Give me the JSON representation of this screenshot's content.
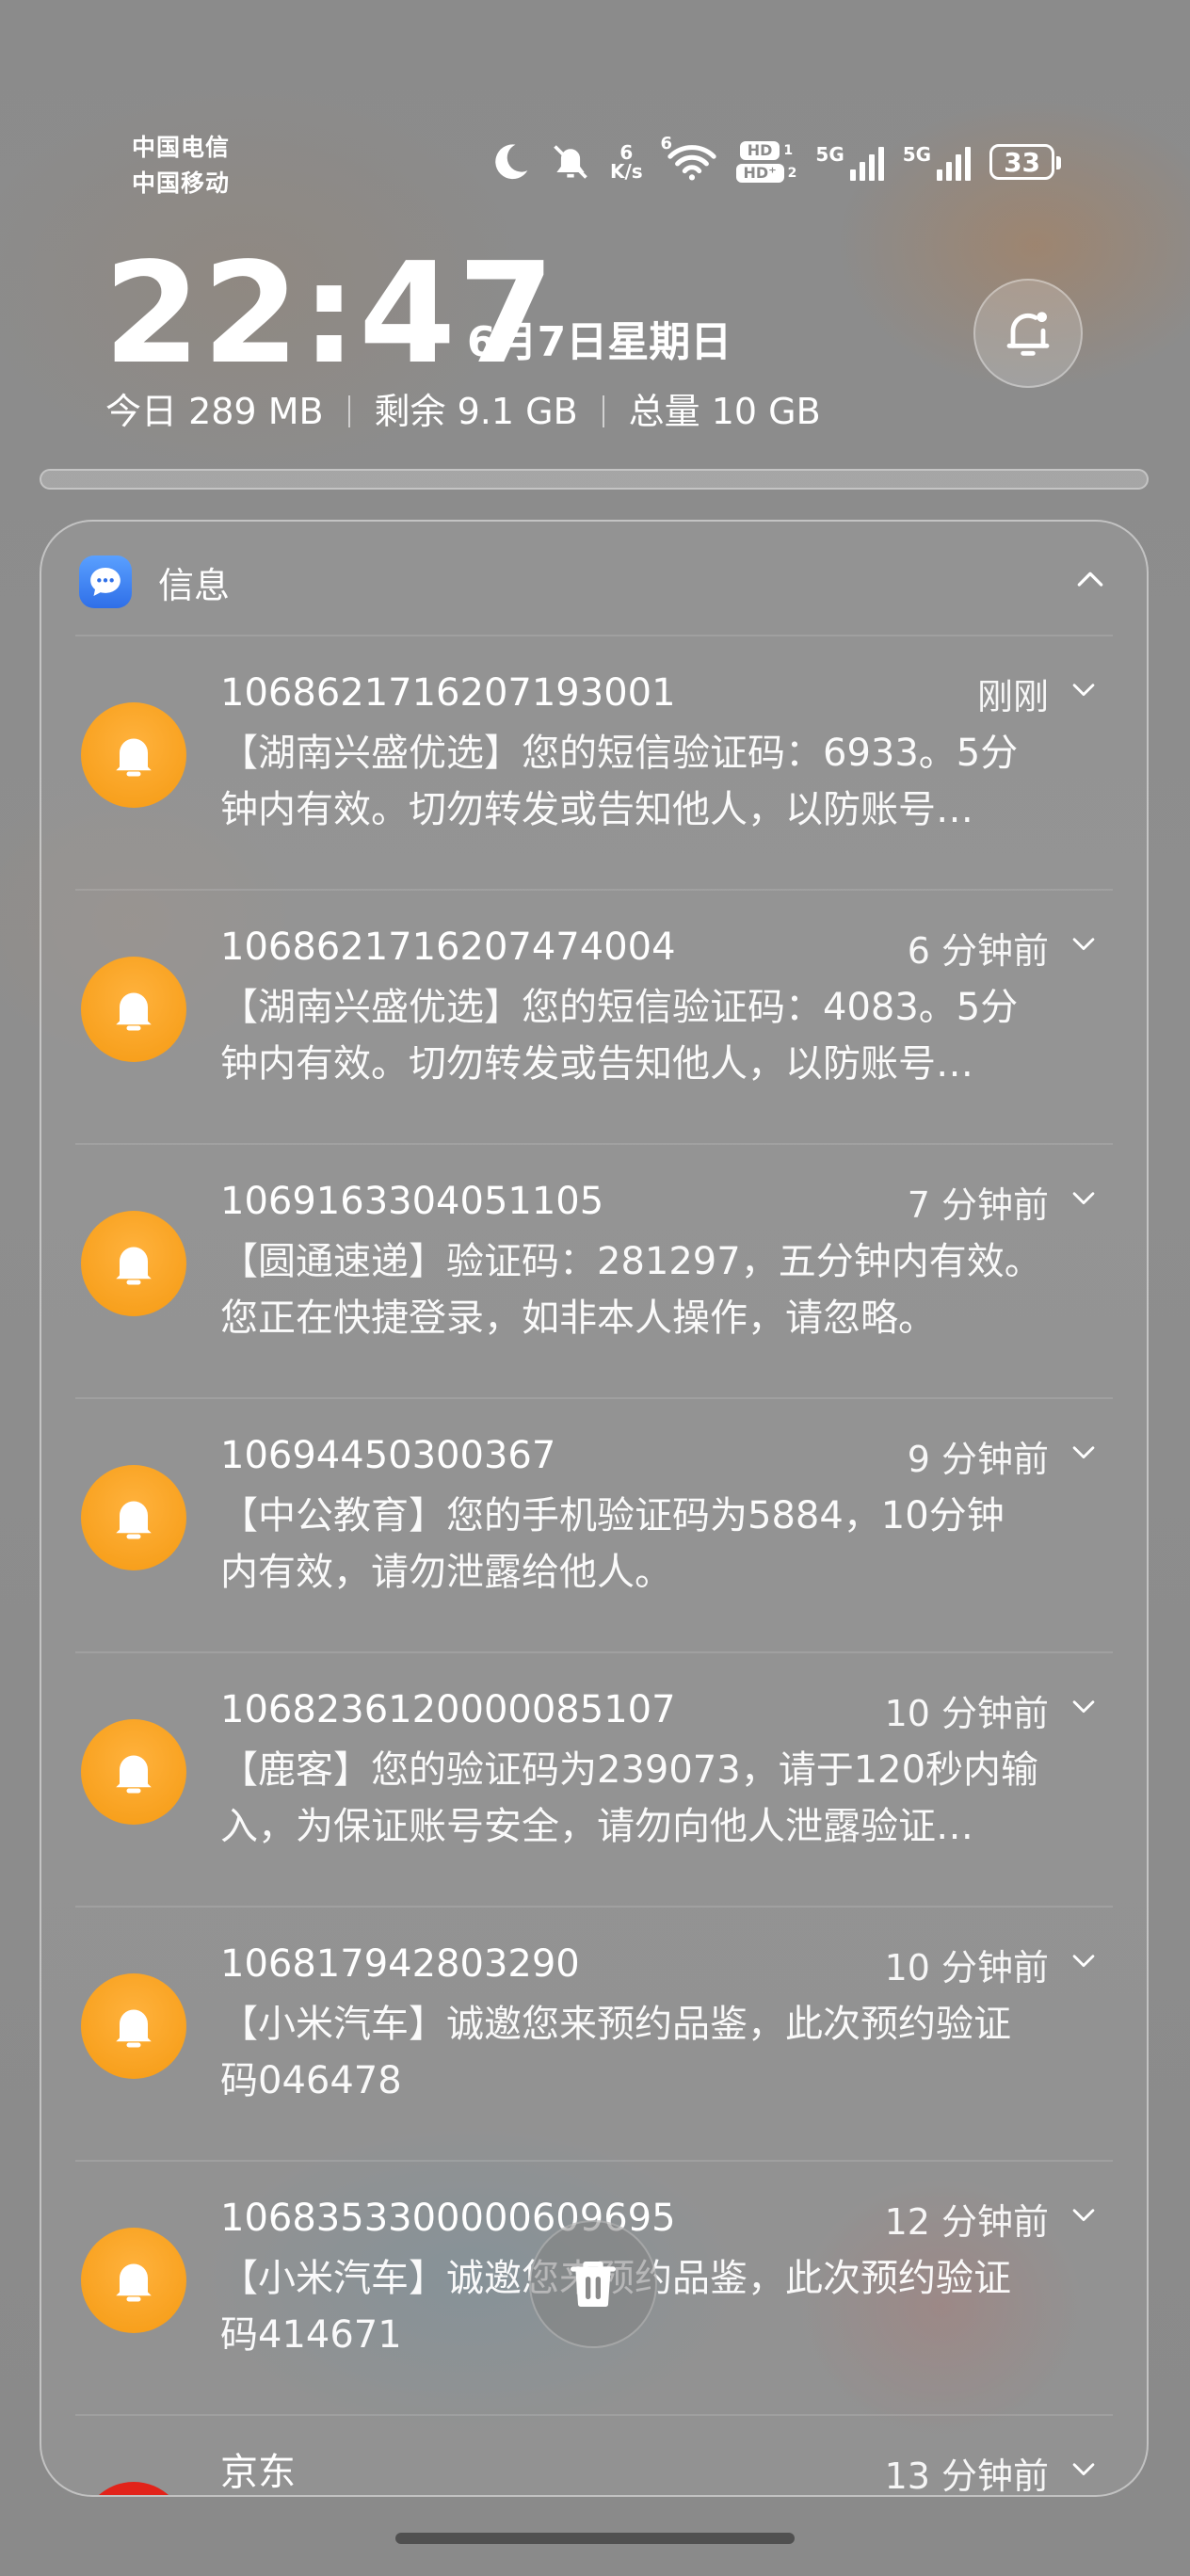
{
  "status_bar": {
    "carriers": [
      "中国电信",
      "中国移动"
    ],
    "net_speed_value": "6",
    "net_speed_unit": "K/s",
    "wifi_badge": "6",
    "hd1": "HD",
    "hd1_sim": "1",
    "hd2": "HD⁺",
    "hd2_sim": "2",
    "sig1_label": "5G",
    "sig2_label": "5G",
    "battery": "33",
    "icons": [
      "moon-icon",
      "bell-off-icon",
      "wifi-icon",
      "signal-icon",
      "battery-icon"
    ]
  },
  "lockscreen": {
    "time": "22:47",
    "date": "6月7日星期日",
    "data_today": "今日 289 MB",
    "data_left": "剩余 9.1 GB",
    "data_total": "总量 10 GB"
  },
  "group": {
    "app_name": "信息",
    "notifications": [
      {
        "sender": "1068621716207193001",
        "time": "刚刚",
        "lines": [
          "【湖南兴盛优选】您的短信验证码：6933。5分",
          "钟内有效。切勿转发或告知他人，以防账号…"
        ]
      },
      {
        "sender": "1068621716207474004",
        "time": "6 分钟前",
        "lines": [
          "【湖南兴盛优选】您的短信验证码：4083。5分",
          "钟内有效。切勿转发或告知他人，以防账号…"
        ]
      },
      {
        "sender": "1069163304051105",
        "time": "7 分钟前",
        "lines": [
          "【圆通速递】验证码：281297，五分钟内有效。",
          "您正在快捷登录，如非本人操作，请忽略。"
        ]
      },
      {
        "sender": "10694450300367",
        "time": "9 分钟前",
        "lines": [
          "【中公教育】您的手机验证码为5884，10分钟",
          "内有效，请勿泄露给他人。"
        ]
      },
      {
        "sender": "1068236120000085107",
        "time": "10 分钟前",
        "lines": [
          "【鹿客】您的验证码为239073，请于120秒内输",
          "入，为保证账号安全，请勿向他人泄露验证…"
        ]
      },
      {
        "sender": "106817942803290",
        "time": "10 分钟前",
        "lines": [
          "【小米汽车】诚邀您来预约品鉴，此次预约验证",
          "码046478"
        ]
      },
      {
        "sender": "1068353300000609695",
        "time": "12 分钟前",
        "lines": [
          "【小米汽车】诚邀您来预约品鉴，此次预约验证",
          "码414671"
        ]
      },
      {
        "sender": "京东",
        "time": "13 分钟前",
        "lines": []
      }
    ]
  },
  "colors": {
    "bell_avatar": "#f59a12",
    "message_app": "#2f6fe8",
    "jd_red": "#e2231a"
  }
}
